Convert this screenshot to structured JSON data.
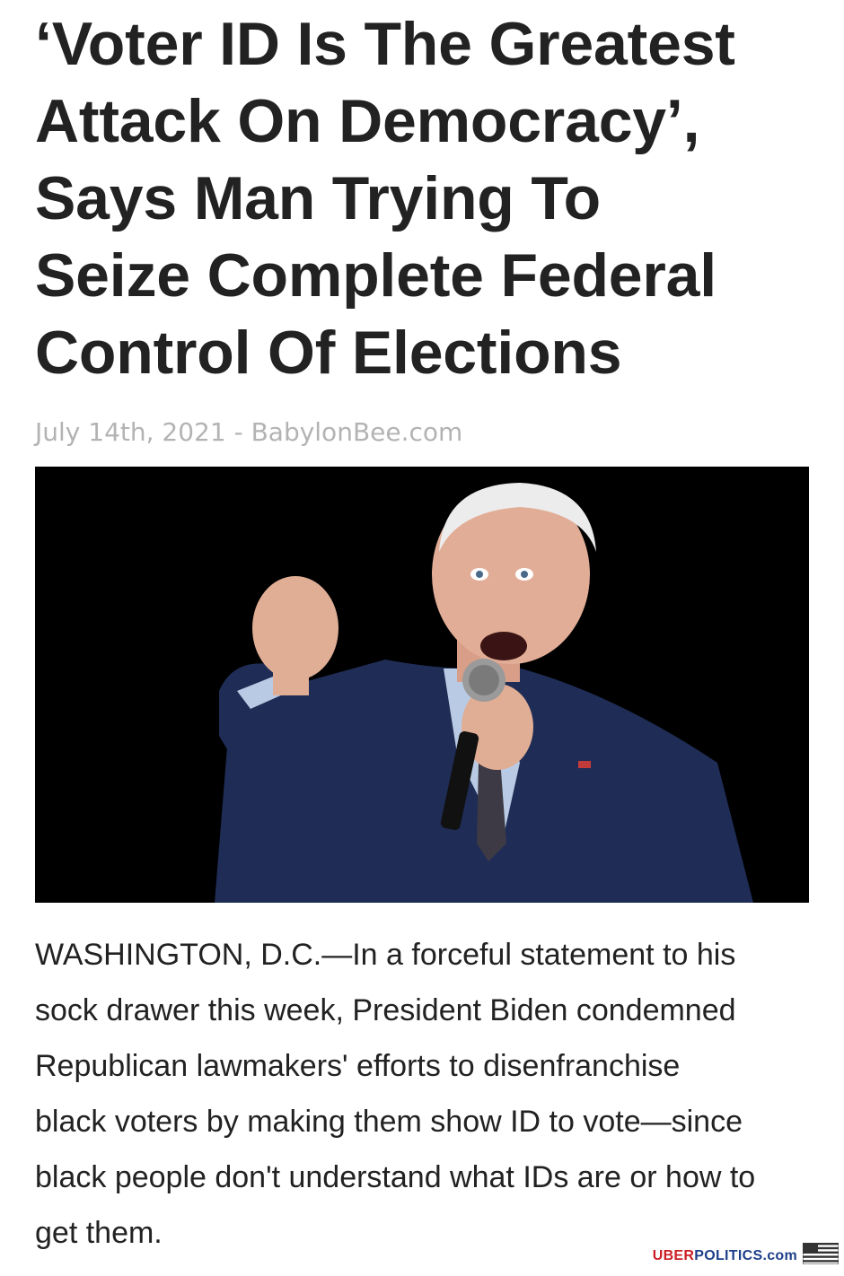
{
  "article": {
    "headline_lines": [
      "‘Voter ID Is The Greatest",
      "Attack On Democracy’,",
      "Says Man Trying To",
      "Seize Complete Federal",
      "Control Of Elections"
    ],
    "byline": "July 14th, 2021 - BabylonBee.com",
    "body_lines": [
      "WASHINGTON, D.C.—In a forceful statement to his",
      "sock drawer this week, President Biden condemned",
      "Republican lawmakers' efforts to disenfranchise",
      "black voters by making them show ID to vote—since",
      "black people don't understand what IDs are or how to",
      "get them."
    ]
  },
  "photo": {
    "subject": "man in navy suit speaking into microphone with raised fist",
    "background_color": "#000000"
  },
  "watermark": {
    "brand_part1": "UBER",
    "brand_part2": "POLITICS",
    "brand_suffix": ".com",
    "icon": "us-flag-icon",
    "colors": {
      "red": "#cc1f25",
      "blue": "#1e3f8a"
    }
  }
}
